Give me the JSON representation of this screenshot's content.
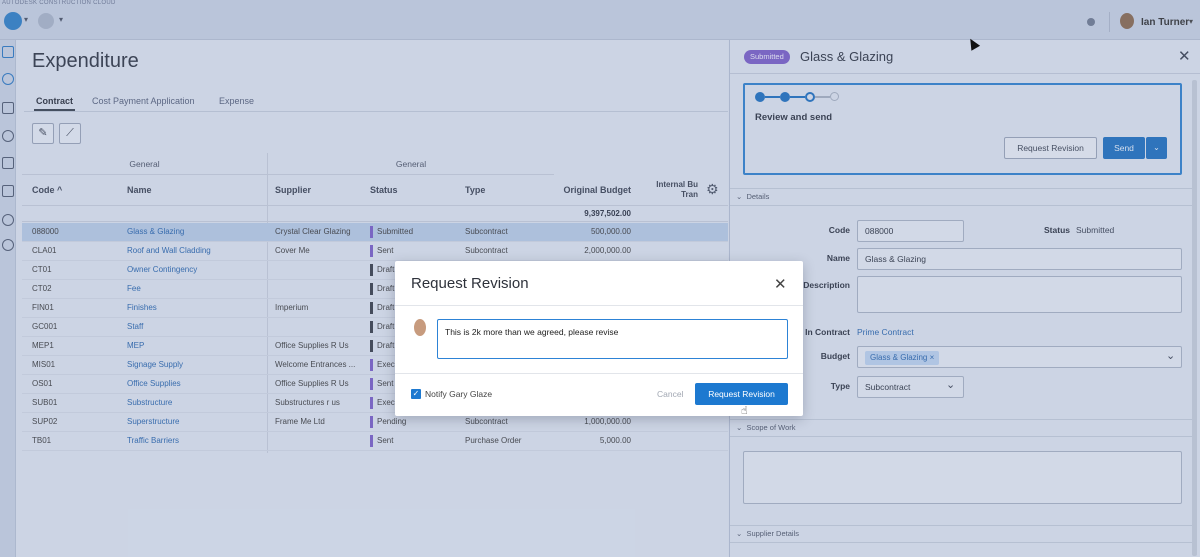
{
  "topbar": {
    "brand": "AUTODESK CONSTRUCTION CLOUD",
    "user_name": "Ian Turner"
  },
  "page": {
    "title": "Expenditure",
    "tabs": [
      "Contract",
      "Cost Payment Application",
      "Expense"
    ],
    "active_tab": "Contract"
  },
  "grid": {
    "groups": [
      "General",
      "General"
    ],
    "headers": {
      "code": "Code ^",
      "name": "Name",
      "supplier": "Supplier",
      "status": "Status",
      "type": "Type",
      "original_budget": "Original Budget",
      "internal_budget": "Internal Bu Tran"
    },
    "total_original_budget": "9,397,502.00",
    "status_colors": {
      "Submitted": "#7a5fc7",
      "Sent": "#7a5fc7",
      "Draft": "#3a3f4a",
      "Executed": "#4a8a57",
      "Pending": "#7a5fc7"
    },
    "rows": [
      {
        "code": "088000",
        "name": "Glass & Glazing",
        "supplier": "Crystal Clear Glazing",
        "status": "Submitted",
        "type": "Subcontract",
        "budget": "500,000.00",
        "selected": true
      },
      {
        "code": "CLA01",
        "name": "Roof and Wall Cladding",
        "supplier": "Cover Me",
        "status": "Sent",
        "type": "Subcontract",
        "budget": "2,000,000.00"
      },
      {
        "code": "CT01",
        "name": "Owner Contingency",
        "supplier": "",
        "status": "Draft",
        "type": "",
        "budget": ""
      },
      {
        "code": "CT02",
        "name": "Fee",
        "supplier": "",
        "status": "Draft",
        "type": "",
        "budget": ""
      },
      {
        "code": "FIN01",
        "name": "Finishes",
        "supplier": "Imperium",
        "status": "Draft",
        "type": "",
        "budget": ""
      },
      {
        "code": "GC001",
        "name": "Staff",
        "supplier": "",
        "status": "Draft",
        "type": "",
        "budget": ""
      },
      {
        "code": "MEP1",
        "name": "MEP",
        "supplier": "Office Supplies R Us",
        "status": "Draft",
        "type": "",
        "budget": ""
      },
      {
        "code": "MIS01",
        "name": "Signage Supply",
        "supplier": "Welcome Entrances ...",
        "status": "Exec",
        "type": "",
        "budget": ""
      },
      {
        "code": "OS01",
        "name": "Office Supplies",
        "supplier": "Office Supplies R Us",
        "status": "Sent",
        "type": "",
        "budget": ""
      },
      {
        "code": "SUB01",
        "name": "Substructure",
        "supplier": "Substructures r us",
        "status": "Exec",
        "type": "",
        "budget": ""
      },
      {
        "code": "SUP02",
        "name": "Superstructure",
        "supplier": "Frame Me Ltd",
        "status": "Pending",
        "type": "Subcontract",
        "budget": "1,000,000.00"
      },
      {
        "code": "TB01",
        "name": "Traffic Barriers",
        "supplier": "",
        "status": "Sent",
        "type": "Purchase Order",
        "budget": "5,000.00"
      }
    ]
  },
  "panel": {
    "status_badge": "Submitted",
    "title": "Glass & Glazing",
    "workflow_label": "Review and send",
    "request_revision_label": "Request Revision",
    "send_label": "Send",
    "details_label": "Details",
    "code_label": "Code",
    "code_value": "088000",
    "status_label": "Status",
    "status_value": "Submitted",
    "name_label": "Name",
    "name_value": "Glass & Glazing",
    "description_label": "Description",
    "main_contract_label": "In Contract",
    "main_contract_value": "Prime Contract",
    "budget_label": "Budget",
    "budget_chip": "Glass & Glazing",
    "type_label": "Type",
    "type_value": "Subcontract",
    "scope_label": "Scope of Work",
    "supplier_details_label": "Supplier Details"
  },
  "dialog": {
    "title": "Request Revision",
    "message": "This is 2k more than we agreed, please revise",
    "notify_label": "Notify Gary Glaze",
    "notify_checked": true,
    "cancel_label": "Cancel",
    "submit_label": "Request Revision"
  }
}
